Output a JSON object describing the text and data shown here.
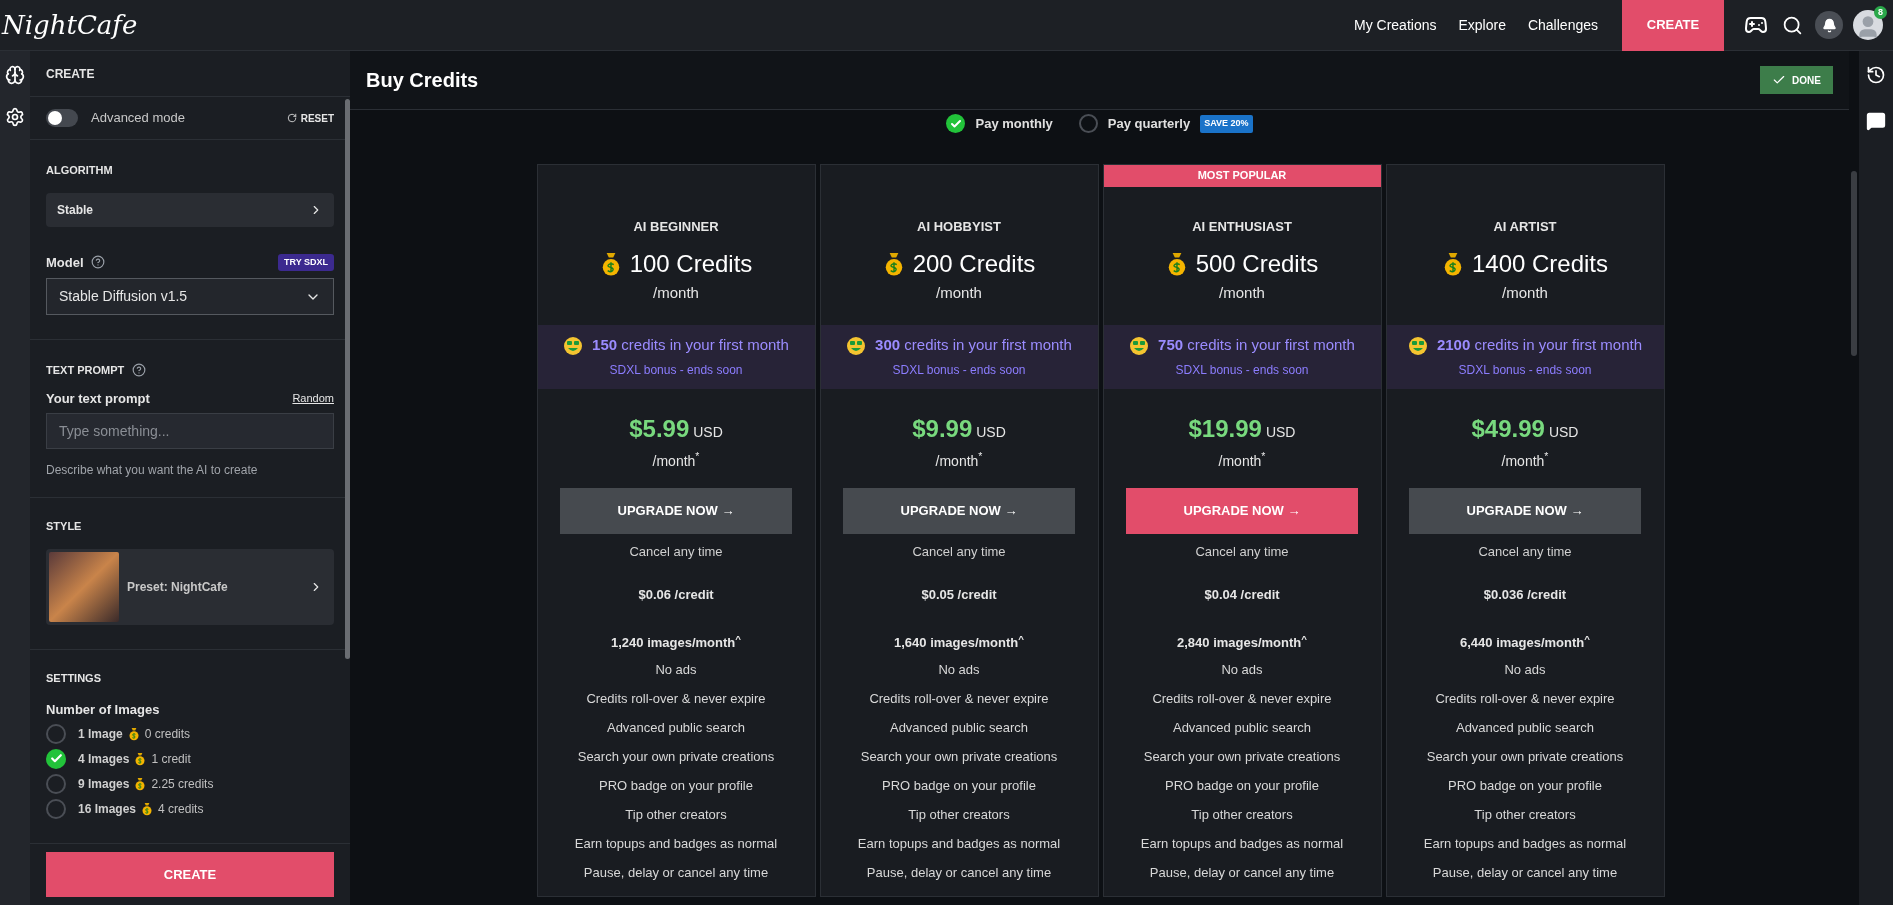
{
  "header": {
    "logo": "NightCafe",
    "nav": [
      "My Creations",
      "Explore",
      "Challenges"
    ],
    "create_button": "CREATE",
    "notification_count": "8"
  },
  "sidebar": {
    "title": "CREATE",
    "advanced_mode": {
      "label": "Advanced mode",
      "on": false
    },
    "reset": "RESET",
    "algorithm": {
      "title": "ALGORITHM",
      "value": "Stable"
    },
    "model": {
      "label": "Model",
      "badge": "TRY SDXL",
      "value": "Stable Diffusion v1.5"
    },
    "text_prompt": {
      "title": "TEXT PROMPT",
      "label": "Your text prompt",
      "link": "Random",
      "placeholder": "Type something...",
      "hint": "Describe what you want the AI to create"
    },
    "style": {
      "title": "STYLE",
      "preset": "Preset: NightCafe"
    },
    "settings": {
      "title": "SETTINGS",
      "label": "Number of Images",
      "options": [
        {
          "count": "1 Image",
          "cost": "0 credits",
          "selected": false
        },
        {
          "count": "4 Images",
          "cost": "1 credit",
          "selected": true
        },
        {
          "count": "9 Images",
          "cost": "2.25 credits",
          "selected": false
        },
        {
          "count": "16 Images",
          "cost": "4 credits",
          "selected": false
        }
      ]
    },
    "create_button": "CREATE"
  },
  "page": {
    "title": "Buy Credits",
    "done_button": "DONE",
    "billing": [
      {
        "label": "Pay monthly",
        "selected": true
      },
      {
        "label": "Pay quarterly",
        "badge": "SAVE 20%",
        "selected": false
      }
    ],
    "plans": [
      {
        "name": "AI BEGINNER",
        "highlighted": false,
        "credits": "100 Credits",
        "per": "/month",
        "bonus": "**150** credits in your first month",
        "bonus_note": "SDXL bonus - ends soon",
        "price": "$5.99",
        "currency": "USD",
        "price_period": "/month$^{*}$",
        "button": "UPGRADE NOW →",
        "cancel": "Cancel any time",
        "per_credit": "$0.06 /credit",
        "images": "1,240 images/month$^{^}$",
        "features": [
          "No ads",
          "Credits roll-over & never expire",
          "Advanced public search",
          "Search your own private creations",
          "PRO badge on your profile",
          "Tip other creators",
          "Earn topups and badges as normal",
          "Pause, delay or cancel any time"
        ]
      },
      {
        "name": "AI HOBBYIST",
        "highlighted": false,
        "credits": "200 Credits",
        "per": "/month",
        "bonus": "**300** credits in your first month",
        "bonus_note": "SDXL bonus - ends soon",
        "price": "$9.99",
        "currency": "USD",
        "price_period": "/month$^{*}$",
        "button": "UPGRADE NOW →",
        "cancel": "Cancel any time",
        "per_credit": "$0.05 /credit",
        "images": "1,640 images/month$^{^}$",
        "features": [
          "No ads",
          "Credits roll-over & never expire",
          "Advanced public search",
          "Search your own private creations",
          "PRO badge on your profile",
          "Tip other creators",
          "Earn topups and badges as normal",
          "Pause, delay or cancel any time"
        ]
      },
      {
        "name": "AI ENTHUSIAST",
        "ribbon": "MOST POPULAR",
        "highlighted": true,
        "credits": "500 Credits",
        "per": "/month",
        "bonus": "**750** credits in your first month",
        "bonus_note": "SDXL bonus - ends soon",
        "price": "$19.99",
        "currency": "USD",
        "price_period": "/month$^{*}$",
        "button": "UPGRADE NOW →",
        "cancel": "Cancel any time",
        "per_credit": "$0.04 /credit",
        "images": "2,840 images/month$^{^}$",
        "features": [
          "No ads",
          "Credits roll-over & never expire",
          "Advanced public search",
          "Search your own private creations",
          "PRO badge on your profile",
          "Tip other creators",
          "Earn topups and badges as normal",
          "Pause, delay or cancel any time"
        ]
      },
      {
        "name": "AI ARTIST",
        "highlighted": false,
        "credits": "1400 Credits",
        "per": "/month",
        "bonus": "**2100** credits in your first month",
        "bonus_note": "SDXL bonus - ends soon",
        "price": "$49.99",
        "currency": "USD",
        "price_period": "/month$^{*}$",
        "button": "UPGRADE NOW →",
        "cancel": "Cancel any time",
        "per_credit": "$0.036 /credit",
        "images": "6,440 images/month$^{^}$",
        "features": [
          "No ads",
          "Credits roll-over & never expire",
          "Advanced public search",
          "Search your own private creations",
          "PRO badge on your profile",
          "Tip other creators",
          "Earn topups and badges as normal",
          "Pause, delay or cancel any time"
        ]
      }
    ]
  }
}
